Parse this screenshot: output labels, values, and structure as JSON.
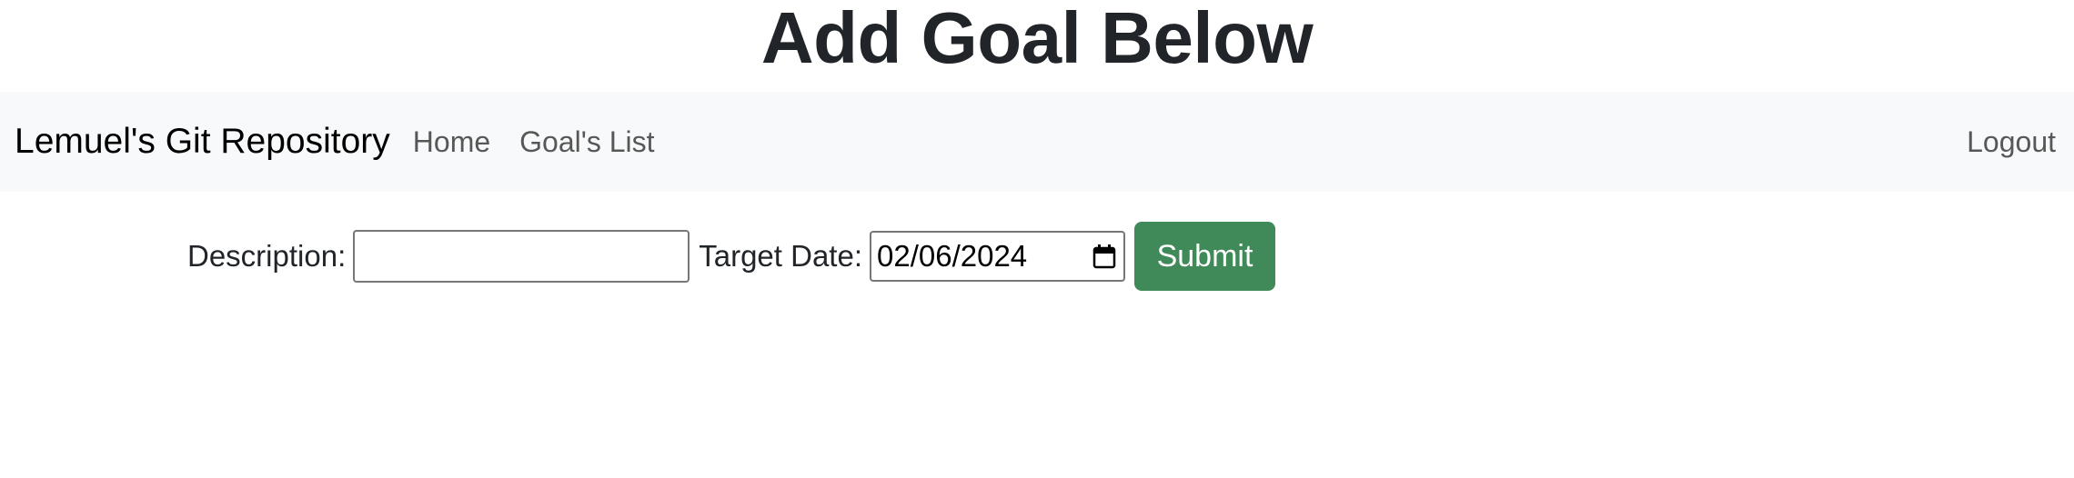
{
  "page": {
    "title": "Add Goal Below"
  },
  "navbar": {
    "brand": "Lemuel's Git Repository",
    "links": [
      {
        "label": "Home"
      },
      {
        "label": "Goal's List"
      }
    ],
    "logout": "Logout"
  },
  "form": {
    "description_label": "Description:",
    "description_value": "",
    "target_date_label": "Target Date:",
    "target_date_value": "02/06/2024",
    "submit_label": "Submit",
    "submit_color": "#3f8a58"
  },
  "icons": {
    "date_picker": "calendar-icon"
  }
}
